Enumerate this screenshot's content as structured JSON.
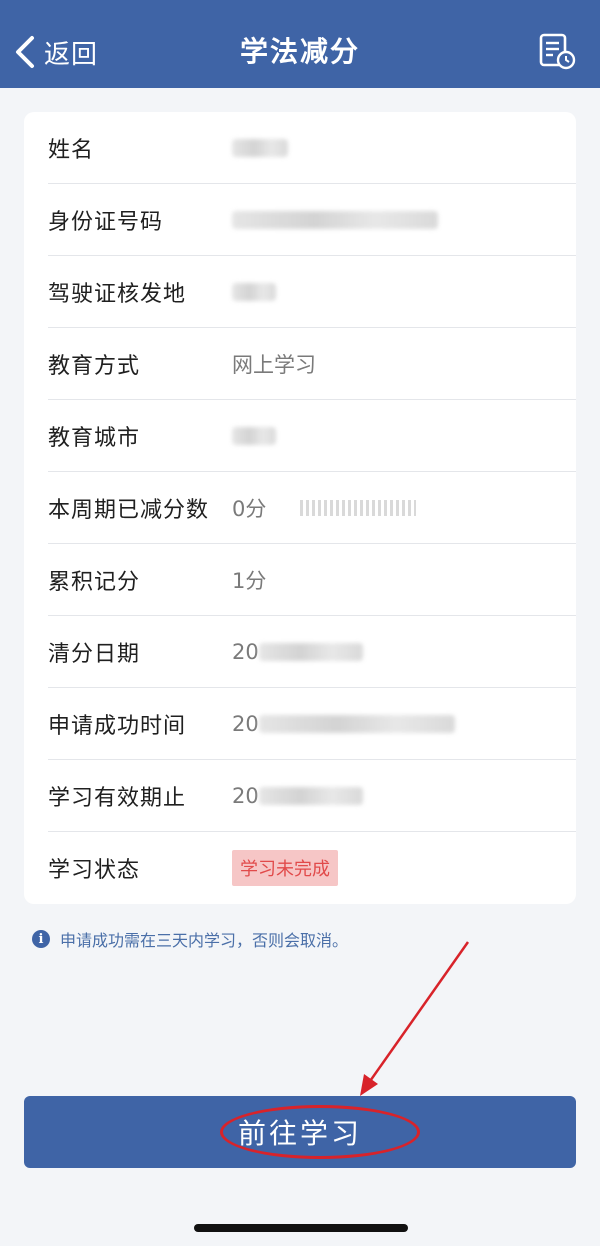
{
  "header": {
    "back_label": "返回",
    "title": "学法减分",
    "right_icon": "document-clock-icon"
  },
  "info": {
    "name_label": "姓名",
    "id_label": "身份证号码",
    "license_place_label": "驾驶证核发地",
    "edu_mode_label": "教育方式",
    "edu_mode_value": "网上学习",
    "edu_city_label": "教育城市",
    "reduced_label": "本周期已减分数",
    "reduced_value": "0分",
    "accum_label": "累积记分",
    "accum_value": "1分",
    "clear_date_label": "清分日期",
    "clear_date_prefix": "20",
    "apply_time_label": "申请成功时间",
    "apply_time_prefix": "20",
    "valid_until_label": "学习有效期止",
    "valid_until_prefix": "20",
    "status_label": "学习状态",
    "status_value": "学习未完成"
  },
  "colors": {
    "primary": "#3f64a6",
    "status_bg": "#f6c6c6",
    "status_text": "#e14a4a",
    "annotation": "#d8232a"
  },
  "notice": {
    "icon": "info-icon",
    "text": "申请成功需在三天内学习，否则会取消。"
  },
  "action": {
    "button_label": "前往学习"
  }
}
